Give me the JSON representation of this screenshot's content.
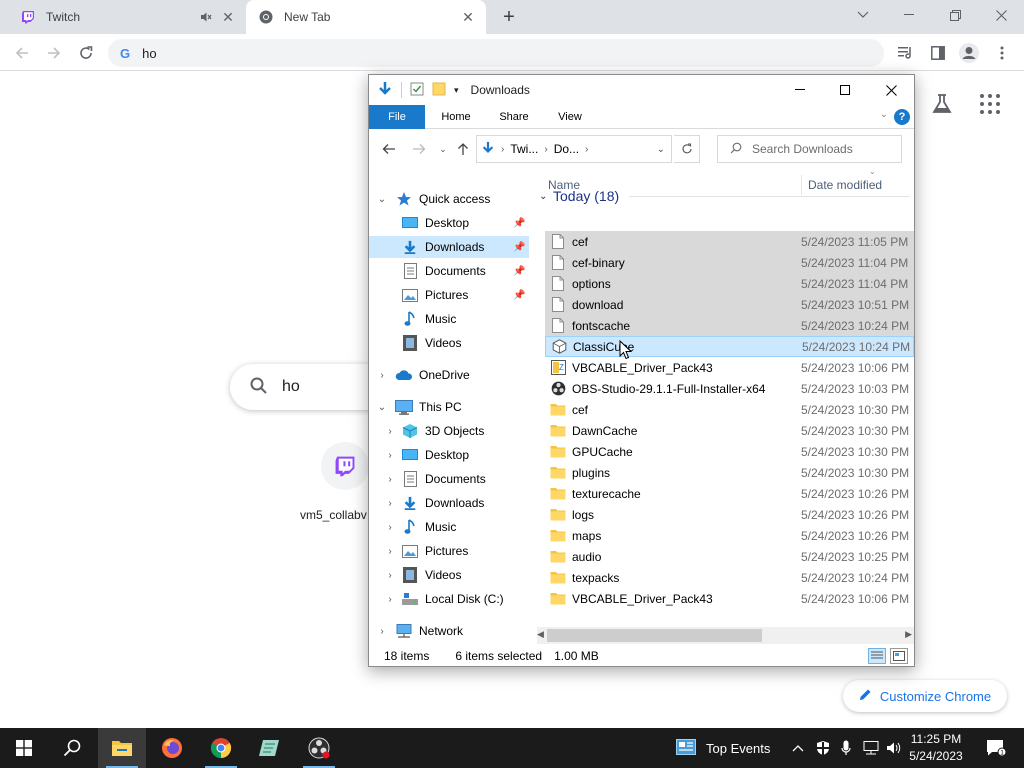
{
  "browser": {
    "tabs": [
      {
        "title": "Twitch",
        "favicon": "twitch-icon",
        "muted": true
      },
      {
        "title": "New Tab",
        "favicon": "chrome-icon",
        "active": true
      }
    ],
    "omnibox": {
      "value": "ho"
    },
    "ntp": {
      "search_value": "ho",
      "shortcut_label": "vm5_collabv",
      "customize_label": "Customize Chrome"
    }
  },
  "explorer": {
    "title": "Downloads",
    "ribbon_tabs": [
      "File",
      "Home",
      "Share",
      "View"
    ],
    "path": [
      "Twi...",
      "Do..."
    ],
    "search_placeholder": "Search Downloads",
    "columns": {
      "name": "Name",
      "date": "Date modified"
    },
    "group_title": "Today (18)",
    "nav": {
      "quick_access": "Quick access",
      "qa_desktop": "Desktop",
      "qa_downloads": "Downloads",
      "qa_documents": "Documents",
      "qa_pictures": "Pictures",
      "qa_music": "Music",
      "qa_videos": "Videos",
      "onedrive": "OneDrive",
      "this_pc": "This PC",
      "pc_3d": "3D Objects",
      "pc_desktop": "Desktop",
      "pc_documents": "Documents",
      "pc_downloads": "Downloads",
      "pc_music": "Music",
      "pc_pictures": "Pictures",
      "pc_videos": "Videos",
      "pc_localdisk": "Local Disk (C:)",
      "network": "Network"
    },
    "files": [
      {
        "name": "cef",
        "date": "5/24/2023 11:05 PM",
        "kind": "file",
        "selected": true
      },
      {
        "name": "cef-binary",
        "date": "5/24/2023 11:04 PM",
        "kind": "file",
        "selected": true
      },
      {
        "name": "options",
        "date": "5/24/2023 11:04 PM",
        "kind": "file",
        "selected": true
      },
      {
        "name": "download",
        "date": "5/24/2023 10:51 PM",
        "kind": "file",
        "selected": true
      },
      {
        "name": "fontscache",
        "date": "5/24/2023 10:24 PM",
        "kind": "file",
        "selected": true
      },
      {
        "name": "ClassiCube",
        "date": "5/24/2023 10:24 PM",
        "kind": "app",
        "selected": true,
        "hover": true
      },
      {
        "name": "VBCABLE_Driver_Pack43",
        "date": "5/24/2023 10:06 PM",
        "kind": "zip"
      },
      {
        "name": "OBS-Studio-29.1.1-Full-Installer-x64",
        "date": "5/24/2023 10:03 PM",
        "kind": "obs"
      },
      {
        "name": "cef",
        "date": "5/24/2023 10:30 PM",
        "kind": "folder"
      },
      {
        "name": "DawnCache",
        "date": "5/24/2023 10:30 PM",
        "kind": "folder"
      },
      {
        "name": "GPUCache",
        "date": "5/24/2023 10:30 PM",
        "kind": "folder"
      },
      {
        "name": "plugins",
        "date": "5/24/2023 10:30 PM",
        "kind": "folder"
      },
      {
        "name": "texturecache",
        "date": "5/24/2023 10:26 PM",
        "kind": "folder"
      },
      {
        "name": "logs",
        "date": "5/24/2023 10:26 PM",
        "kind": "folder"
      },
      {
        "name": "maps",
        "date": "5/24/2023 10:26 PM",
        "kind": "folder"
      },
      {
        "name": "audio",
        "date": "5/24/2023 10:25 PM",
        "kind": "folder"
      },
      {
        "name": "texpacks",
        "date": "5/24/2023 10:24 PM",
        "kind": "folder"
      },
      {
        "name": "VBCABLE_Driver_Pack43",
        "date": "5/24/2023 10:06 PM",
        "kind": "folder"
      }
    ],
    "status": {
      "items": "18 items",
      "selected": "6 items selected",
      "size": "1.00 MB"
    }
  },
  "taskbar": {
    "top_events": "Top Events",
    "time": "11:25 PM",
    "date": "5/24/2023",
    "notification_count": "1"
  },
  "colors": {
    "accent": "#1979ca",
    "selection": "#cce8ff",
    "folder": "#ffd766",
    "taskbar": "#1b1b1b"
  }
}
